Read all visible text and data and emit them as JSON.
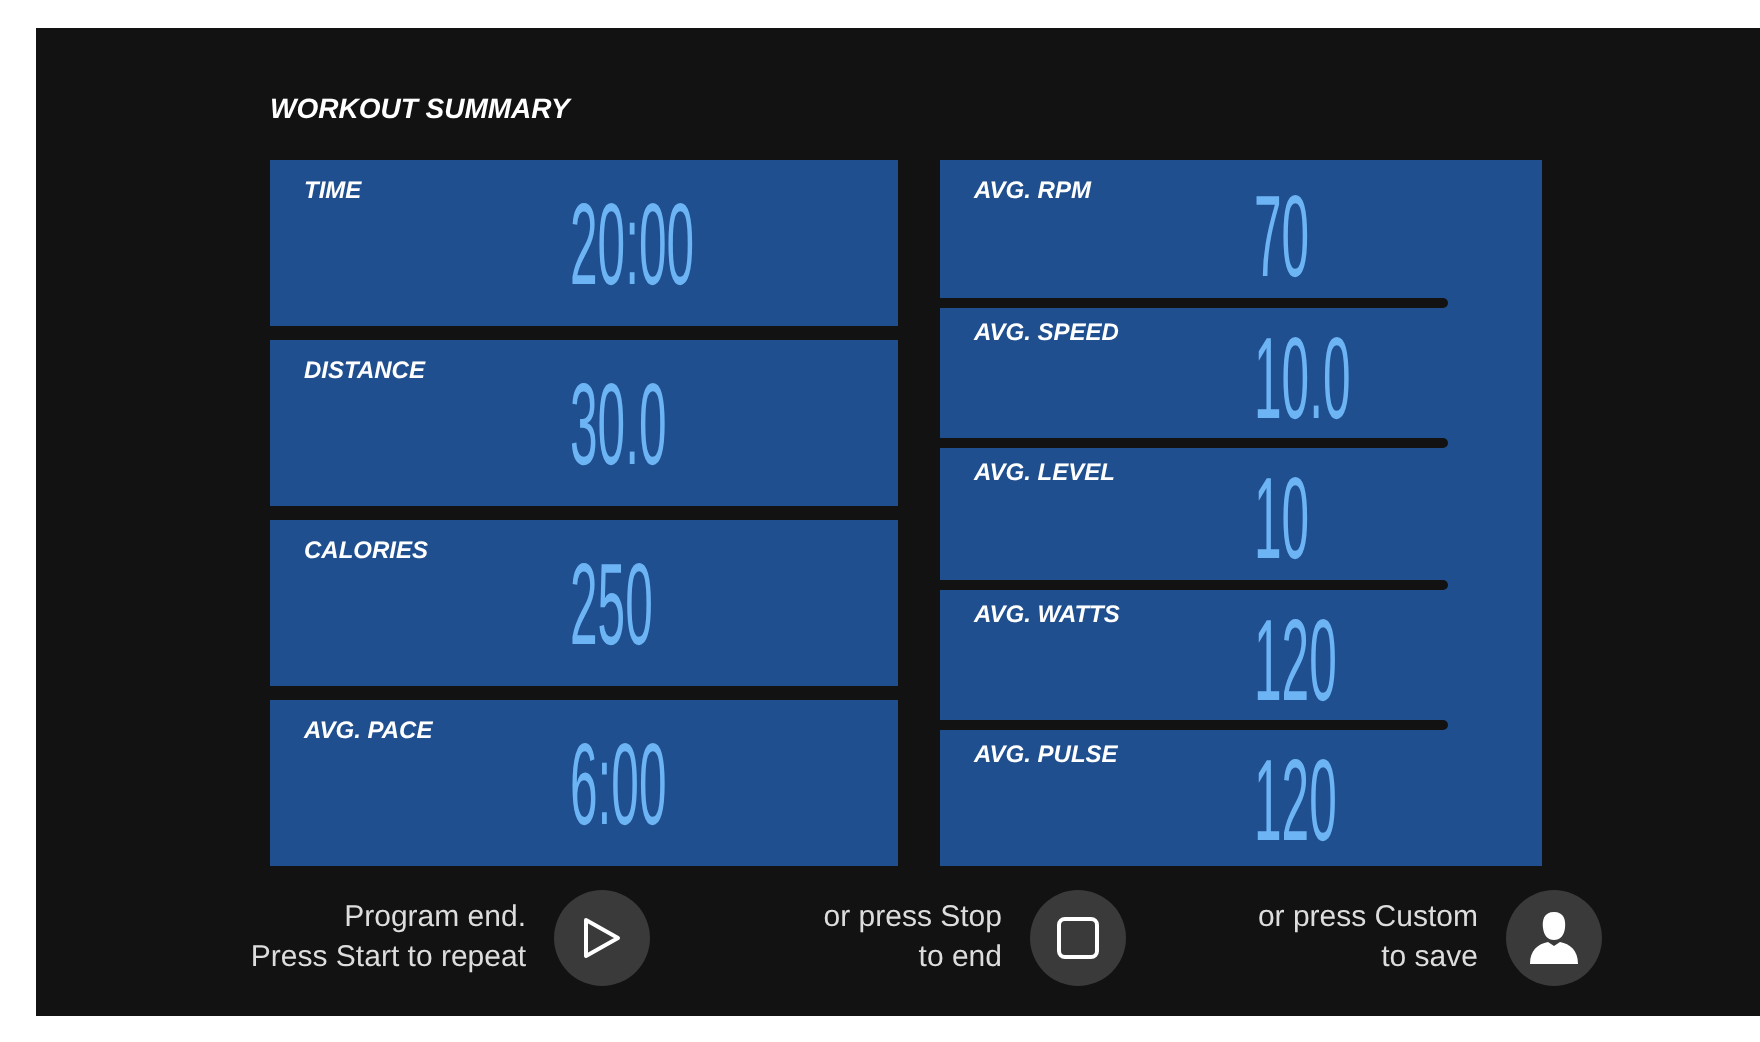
{
  "title": "WORKOUT SUMMARY",
  "left_stats": [
    {
      "label": "TIME",
      "value": "20:00"
    },
    {
      "label": "DISTANCE",
      "value": "30.0"
    },
    {
      "label": "CALORIES",
      "value": "250"
    },
    {
      "label": "AVG. PACE",
      "value": "6:00"
    }
  ],
  "right_stats": [
    {
      "label": "AVG. RPM",
      "value": "70"
    },
    {
      "label": "AVG. SPEED",
      "value": "10.0"
    },
    {
      "label": "AVG. LEVEL",
      "value": "10"
    },
    {
      "label": "AVG. WATTS",
      "value": "120"
    },
    {
      "label": "AVG. PULSE",
      "value": "120"
    }
  ],
  "actions": [
    {
      "text": [
        "Program end.",
        "Press Start to repeat"
      ],
      "kind": "start"
    },
    {
      "text": [
        "or press Stop",
        "to end"
      ],
      "kind": "stop"
    },
    {
      "text": [
        "or press Custom",
        "to save"
      ],
      "kind": "custom"
    }
  ]
}
